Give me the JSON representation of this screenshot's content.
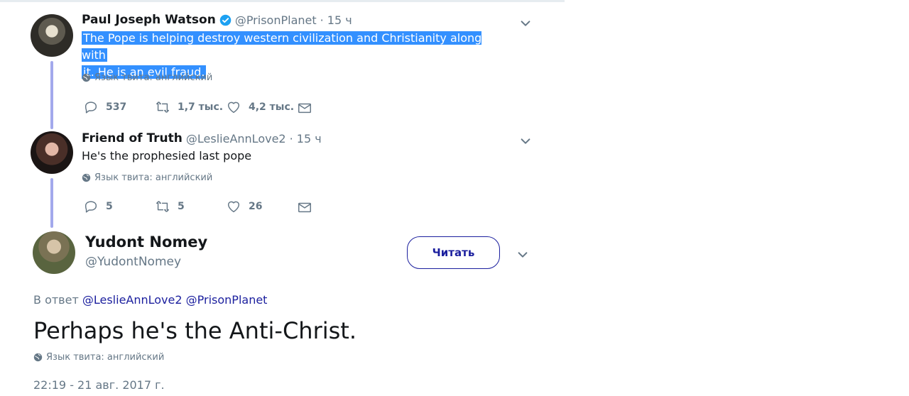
{
  "tweets": [
    {
      "name": "Paul Joseph Watson",
      "handle": "@PrisonPlanet",
      "time": "· 15 ч",
      "text_line1": "The Pope is helping destroy western civilization and Christianity along with",
      "text_line2": "it. He is an evil fraud.",
      "lang": "Язык твита: английский",
      "replies": "537",
      "retweets": "1,7 тыс.",
      "likes": "4,2 тыс."
    },
    {
      "name": "Friend of Truth",
      "handle": "@LeslieAnnLove2",
      "time": "· 15 ч",
      "text": "He's the prophesied last pope",
      "lang": "Язык твита: английский",
      "replies": "5",
      "retweets": "5",
      "likes": "26"
    }
  ],
  "main": {
    "name": "Yudont Nomey",
    "handle": "@YudontNomey",
    "follow_label": "Читать",
    "reply_prefix": "В ответ",
    "mention1": "@LeslieAnnLove2",
    "mention2": "@PrisonPlanet",
    "text": "Perhaps he's the Anti-Christ.",
    "lang": "Язык твита: английский",
    "timestamp": "22:19 - 21 авг. 2017 г."
  },
  "colors": {
    "accent": "#1b1f9e",
    "highlight": "#3390ff",
    "thread_line": "#a3a9ec",
    "muted": "#657786"
  },
  "icons": [
    "verified-badge-icon",
    "chevron-down-icon",
    "reply-icon",
    "retweet-icon",
    "like-icon",
    "direct-message-icon",
    "globe-icon"
  ]
}
